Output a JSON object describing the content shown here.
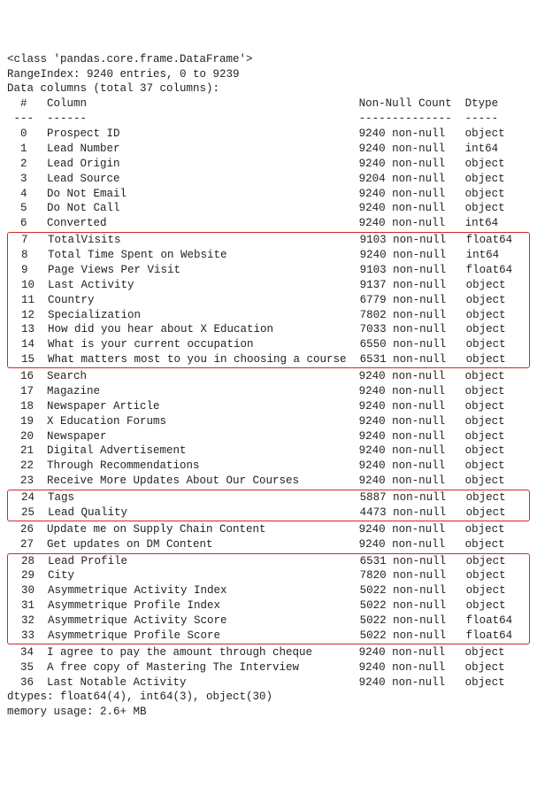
{
  "class_line": "<class 'pandas.core.frame.DataFrame'>",
  "rangeindex_line": "RangeIndex: 9240 entries, 0 to 9239",
  "datacols_line": "Data columns (total 37 columns):",
  "header": {
    "idx": " #",
    "col": "Column",
    "nn": "Non-Null Count",
    "dt": "Dtype "
  },
  "separator": {
    "idx": "---",
    "col": "------",
    "nn": "--------------",
    "dt": "----- "
  },
  "groups": [
    {
      "highlight": false,
      "rows": [
        {
          "idx": " 0",
          "col": "Prospect ID",
          "nn": "9240 non-null",
          "dt": "object"
        },
        {
          "idx": " 1",
          "col": "Lead Number",
          "nn": "9240 non-null",
          "dt": "int64"
        },
        {
          "idx": " 2",
          "col": "Lead Origin",
          "nn": "9240 non-null",
          "dt": "object"
        },
        {
          "idx": " 3",
          "col": "Lead Source",
          "nn": "9204 non-null",
          "dt": "object"
        },
        {
          "idx": " 4",
          "col": "Do Not Email",
          "nn": "9240 non-null",
          "dt": "object"
        },
        {
          "idx": " 5",
          "col": "Do Not Call",
          "nn": "9240 non-null",
          "dt": "object"
        },
        {
          "idx": " 6",
          "col": "Converted",
          "nn": "9240 non-null",
          "dt": "int64"
        }
      ]
    },
    {
      "highlight": true,
      "rows": [
        {
          "idx": " 7",
          "col": "TotalVisits",
          "nn": "9103 non-null",
          "dt": "float64"
        },
        {
          "idx": " 8",
          "col": "Total Time Spent on Website",
          "nn": "9240 non-null",
          "dt": "int64"
        },
        {
          "idx": " 9",
          "col": "Page Views Per Visit",
          "nn": "9103 non-null",
          "dt": "float64"
        },
        {
          "idx": " 10",
          "col": "Last Activity",
          "nn": "9137 non-null",
          "dt": "object"
        },
        {
          "idx": " 11",
          "col": "Country",
          "nn": "6779 non-null",
          "dt": "object"
        },
        {
          "idx": " 12",
          "col": "Specialization",
          "nn": "7802 non-null",
          "dt": "object"
        },
        {
          "idx": " 13",
          "col": "How did you hear about X Education",
          "nn": "7033 non-null",
          "dt": "object"
        },
        {
          "idx": " 14",
          "col": "What is your current occupation",
          "nn": "6550 non-null",
          "dt": "object"
        },
        {
          "idx": " 15",
          "col": "What matters most to you in choosing a course",
          "nn": "6531 non-null",
          "dt": "object"
        }
      ]
    },
    {
      "highlight": false,
      "rows": [
        {
          "idx": " 16",
          "col": "Search",
          "nn": "9240 non-null",
          "dt": "object"
        },
        {
          "idx": " 17",
          "col": "Magazine",
          "nn": "9240 non-null",
          "dt": "object"
        },
        {
          "idx": " 18",
          "col": "Newspaper Article",
          "nn": "9240 non-null",
          "dt": "object"
        },
        {
          "idx": " 19",
          "col": "X Education Forums",
          "nn": "9240 non-null",
          "dt": "object"
        },
        {
          "idx": " 20",
          "col": "Newspaper",
          "nn": "9240 non-null",
          "dt": "object"
        },
        {
          "idx": " 21",
          "col": "Digital Advertisement",
          "nn": "9240 non-null",
          "dt": "object"
        },
        {
          "idx": " 22",
          "col": "Through Recommendations",
          "nn": "9240 non-null",
          "dt": "object"
        },
        {
          "idx": " 23",
          "col": "Receive More Updates About Our Courses",
          "nn": "9240 non-null",
          "dt": "object"
        }
      ]
    },
    {
      "highlight": true,
      "rows": [
        {
          "idx": " 24",
          "col": "Tags",
          "nn": "5887 non-null",
          "dt": "object"
        },
        {
          "idx": " 25",
          "col": "Lead Quality",
          "nn": "4473 non-null",
          "dt": "object"
        }
      ]
    },
    {
      "highlight": false,
      "rows": [
        {
          "idx": " 26",
          "col": "Update me on Supply Chain Content",
          "nn": "9240 non-null",
          "dt": "object"
        },
        {
          "idx": " 27",
          "col": "Get updates on DM Content",
          "nn": "9240 non-null",
          "dt": "object"
        }
      ]
    },
    {
      "highlight": true,
      "rows": [
        {
          "idx": " 28",
          "col": "Lead Profile",
          "nn": "6531 non-null",
          "dt": "object"
        },
        {
          "idx": " 29",
          "col": "City",
          "nn": "7820 non-null",
          "dt": "object"
        },
        {
          "idx": " 30",
          "col": "Asymmetrique Activity Index",
          "nn": "5022 non-null",
          "dt": "object"
        },
        {
          "idx": " 31",
          "col": "Asymmetrique Profile Index",
          "nn": "5022 non-null",
          "dt": "object"
        },
        {
          "idx": " 32",
          "col": "Asymmetrique Activity Score",
          "nn": "5022 non-null",
          "dt": "float64"
        },
        {
          "idx": " 33",
          "col": "Asymmetrique Profile Score",
          "nn": "5022 non-null",
          "dt": "float64"
        }
      ]
    },
    {
      "highlight": false,
      "rows": [
        {
          "idx": " 34",
          "col": "I agree to pay the amount through cheque",
          "nn": "9240 non-null",
          "dt": "object"
        },
        {
          "idx": " 35",
          "col": "A free copy of Mastering The Interview",
          "nn": "9240 non-null",
          "dt": "object"
        },
        {
          "idx": " 36",
          "col": "Last Notable Activity",
          "nn": "9240 non-null",
          "dt": "object"
        }
      ]
    }
  ],
  "dtypes_line": "dtypes: float64(4), int64(3), object(30)",
  "memory_line": "memory usage: 2.6+ MB",
  "widths": {
    "idx": 3,
    "col": 47,
    "nn": 16,
    "dt": 7
  }
}
